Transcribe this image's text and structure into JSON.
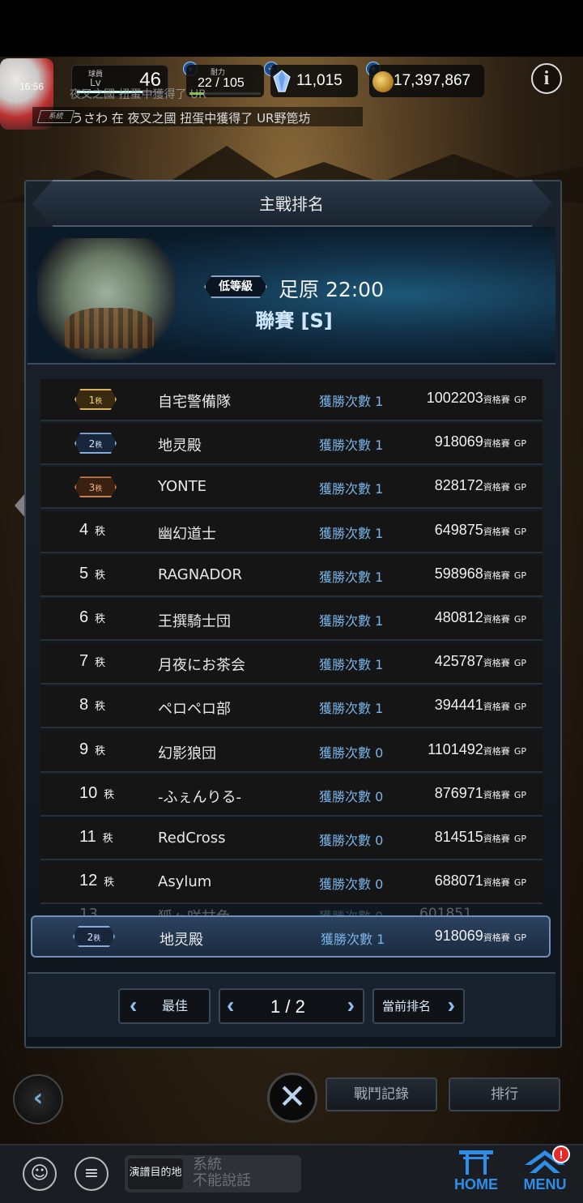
{
  "hud": {
    "clock": "16:56",
    "level_tag": "球員",
    "level_label": "Lv",
    "level": "46",
    "level_progress": 0.75,
    "stamina_tag": "耐力",
    "stamina": "22 / 105",
    "stamina_progress": 0.21,
    "gems": "11,015",
    "coins": "17,397,867",
    "plus": "+",
    "info": "i",
    "ticker_prev": "夜叉之國 扭蛋中獲得了 UR",
    "ticker_badge": "系統",
    "ticker": "うさわ 在 夜叉之國 扭蛋中獲得了 UR野箆坊"
  },
  "panel": {
    "title": "主戰排名",
    "grade": "低等級",
    "venue": "足原 22:00",
    "league": "聯賽 [S]"
  },
  "rows": [
    {
      "rank": "1",
      "medal": "gold",
      "name": "自宅警備隊",
      "wins": "獲勝次數 1",
      "gp": "1002203"
    },
    {
      "rank": "2",
      "medal": "silver",
      "name": "地灵殿",
      "wins": "獲勝次數 1",
      "gp": "918069"
    },
    {
      "rank": "3",
      "medal": "bronze",
      "name": "YONTE",
      "wins": "獲勝次數 1",
      "gp": "828172"
    },
    {
      "rank": "4",
      "medal": "",
      "name": "幽幻道士",
      "wins": "獲勝次數 1",
      "gp": "649875"
    },
    {
      "rank": "5",
      "medal": "",
      "name": "RAGNADOR",
      "wins": "獲勝次數 1",
      "gp": "598968"
    },
    {
      "rank": "6",
      "medal": "",
      "name": "王撰騎士団",
      "wins": "獲勝次數 1",
      "gp": "480812"
    },
    {
      "rank": "7",
      "medal": "",
      "name": "月夜にお茶会",
      "wins": "獲勝次數 1",
      "gp": "425787"
    },
    {
      "rank": "8",
      "medal": "",
      "name": "ペロペロ部",
      "wins": "獲勝次數 1",
      "gp": "394441"
    },
    {
      "rank": "9",
      "medal": "",
      "name": "幻影狼団",
      "wins": "獲勝次數 0",
      "gp": "1101492"
    },
    {
      "rank": "10",
      "medal": "",
      "name": "-ふぇんりる-",
      "wins": "獲勝次數 0",
      "gp": "876971"
    },
    {
      "rank": "11",
      "medal": "",
      "name": "RedCross",
      "wins": "獲勝次數 0",
      "gp": "814515"
    },
    {
      "rank": "12",
      "medal": "",
      "name": "Asylum",
      "wins": "獲勝次數 0",
      "gp": "688071"
    }
  ],
  "rank_unit": "秩",
  "gp_unit_text": "資格賽",
  "gp_suffix": "GP",
  "faded_row": {
    "rank": "13",
    "name": "狐ヶ咲甘色",
    "wins": "獲勝次數 0",
    "gp": "601851"
  },
  "self_row": {
    "rank": "2",
    "name": "地灵殿",
    "wins": "獲勝次數 1",
    "gp": "918069"
  },
  "pager": {
    "best_label": "最佳",
    "page": "1 / 2",
    "current_label": "當前排名"
  },
  "controls": {
    "battle_log": "戰鬥記錄",
    "ranking": "排行",
    "close": "✕"
  },
  "bottom": {
    "dest_tag": "演譜目的地",
    "chat_placeholder_1": "系統",
    "chat_placeholder_2": "不能說話",
    "home": "HOME",
    "menu": "MENU",
    "badge": "!"
  }
}
